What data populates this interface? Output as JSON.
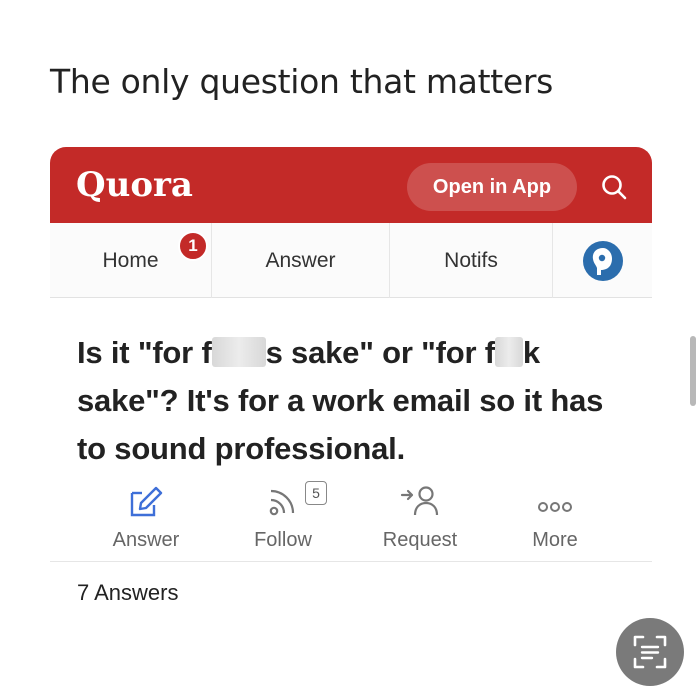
{
  "caption": "The only question that matters",
  "header": {
    "logo": "Quora",
    "open_app_label": "Open in App",
    "search_icon": "search-icon",
    "brand_color": "#c32a28"
  },
  "nav": {
    "home_label": "Home",
    "home_badge": "1",
    "answer_label": "Answer",
    "notifs_label": "Notifs",
    "profile_icon": "avatar-icon"
  },
  "question": {
    "title_line1": "Is it \"for f",
    "title_line1_mid": "s sake\" or \"for f",
    "title_line1_end": "k",
    "title_rest": "sake\"? It's for a work email so it has to sound professional."
  },
  "actions": {
    "answer_label": "Answer",
    "follow_label": "Follow",
    "follow_count": "5",
    "request_label": "Request",
    "more_label": "More"
  },
  "answers_count": "7 Answers"
}
